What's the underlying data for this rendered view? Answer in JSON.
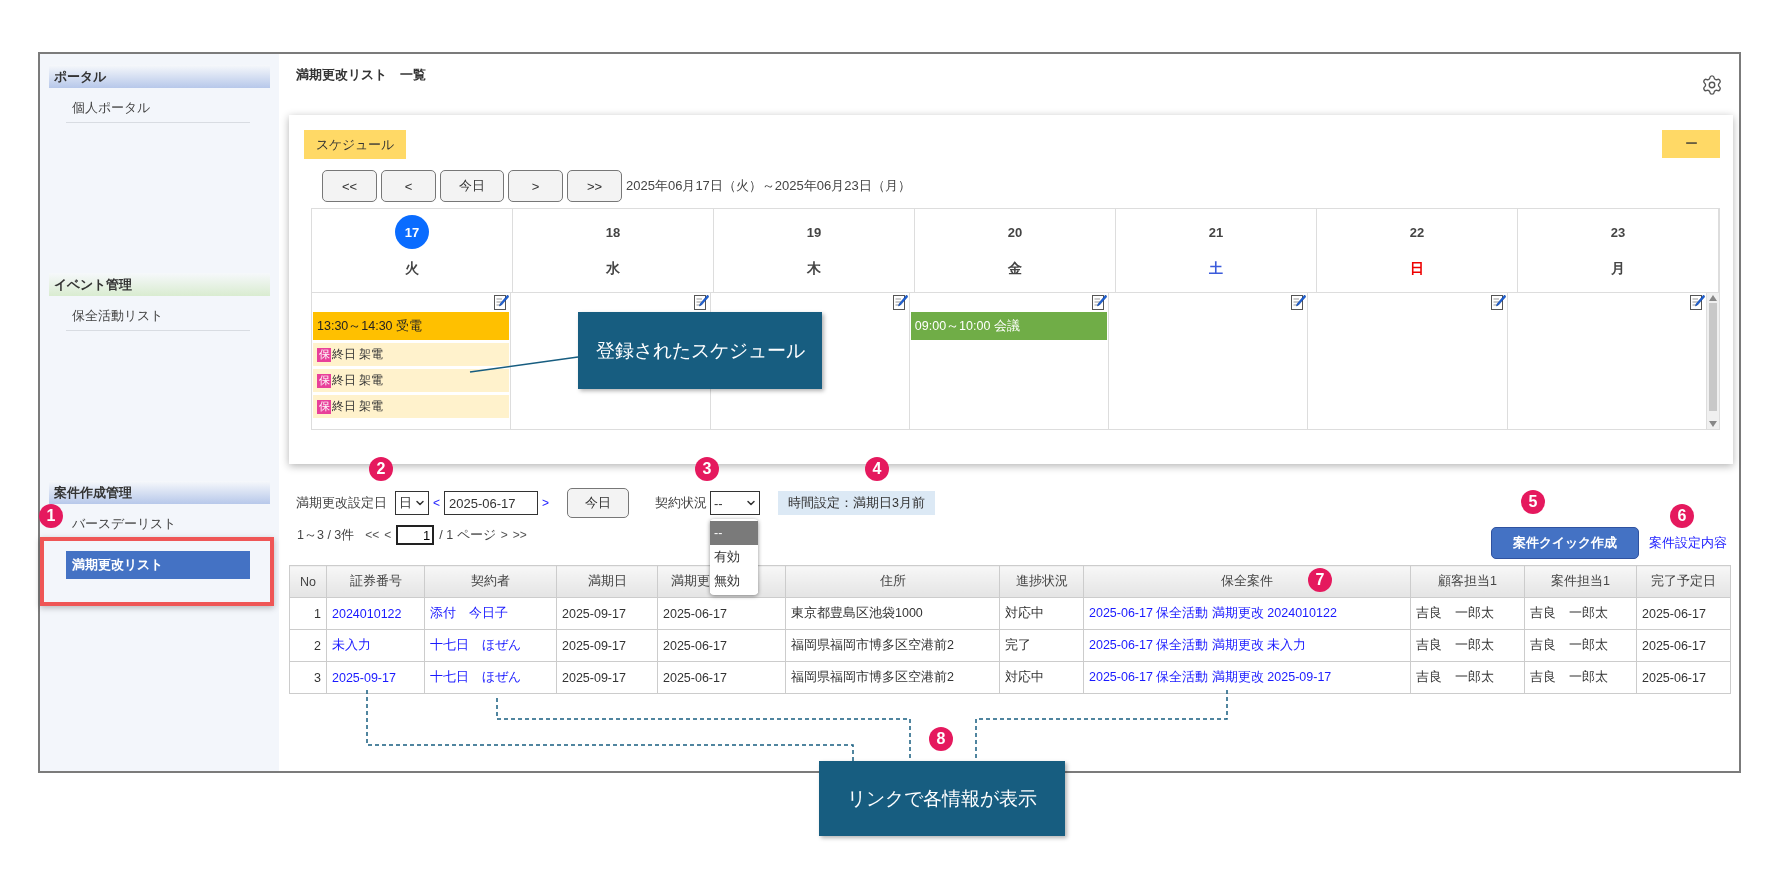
{
  "sidebar": {
    "sections": [
      {
        "title": "ポータル",
        "color": "#b7c8ea",
        "items": [
          {
            "label": "個人ポータル",
            "selected": false
          }
        ]
      },
      {
        "title": "イベント管理",
        "color": "#d9ecd0",
        "items": [
          {
            "label": "保全活動リスト",
            "selected": false
          }
        ]
      },
      {
        "title": "案件作成管理",
        "color": "#b7c8ea",
        "items": [
          {
            "label": "バースデーリスト",
            "selected": false
          },
          {
            "label": "満期更改リスト",
            "selected": true
          }
        ]
      }
    ]
  },
  "page_title": "満期更改リスト　一覧",
  "schedule": {
    "label": "スケジュール",
    "collapse_button": "ー",
    "nav_buttons": [
      "<<",
      "<",
      "今日",
      ">",
      ">>"
    ],
    "range": "2025年06月17日（火）～2025年06月23日（月）",
    "days": [
      {
        "date": "17",
        "weekday": "火",
        "today": true,
        "color": "#444444",
        "events": [
          {
            "kind": "timed",
            "text": "13:30～14:30 受電",
            "color": "#ffc000"
          },
          {
            "kind": "allday",
            "badge": "保",
            "text": "終日 架電"
          },
          {
            "kind": "allday",
            "badge": "保",
            "text": "終日 架電"
          },
          {
            "kind": "allday",
            "badge": "保",
            "text": "終日 架電"
          }
        ]
      },
      {
        "date": "18",
        "weekday": "水",
        "today": false,
        "color": "#444444"
      },
      {
        "date": "19",
        "weekday": "木",
        "today": false,
        "color": "#444444"
      },
      {
        "date": "20",
        "weekday": "金",
        "today": false,
        "color": "#444444",
        "events": [
          {
            "kind": "timed",
            "text": "09:00～10:00 会議",
            "color": "#70ad47"
          }
        ]
      },
      {
        "date": "21",
        "weekday": "土",
        "today": false,
        "color": "#3b5bdb"
      },
      {
        "date": "22",
        "weekday": "日",
        "today": false,
        "color": "#ee0000"
      },
      {
        "date": "23",
        "weekday": "月",
        "today": false,
        "color": "#444444"
      }
    ]
  },
  "filters": {
    "date_label": "満期更改設定日",
    "unit": "日",
    "prev": "<",
    "date": "2025-06-17",
    "next": ">",
    "today_button": "今日",
    "status_label": "契約状況",
    "status_value": "--",
    "status_options": [
      {
        "label": "--",
        "selected": true
      },
      {
        "label": "有効",
        "selected": false
      },
      {
        "label": "無効",
        "selected": false
      }
    ],
    "time_setting": "時間設定：満期日3月前"
  },
  "pagination": {
    "summary": "1～3 / 3件",
    "first": "<<",
    "prev": "<",
    "page": "1",
    "total": "/ 1 ページ",
    "next": ">",
    "last": ">>"
  },
  "actions": {
    "quick_create": "案件クイック作成",
    "settings_link": "案件設定内容"
  },
  "table": {
    "columns": [
      {
        "label": "No",
        "cut": false
      },
      {
        "label": "証券番号",
        "cut": false
      },
      {
        "label": "契約者",
        "cut": false
      },
      {
        "label": "満期日",
        "cut": false
      },
      {
        "label": "満期更",
        "cut": true
      },
      {
        "label": "住所",
        "cut": false
      },
      {
        "label": "進捗状況",
        "cut": false
      },
      {
        "label": "保全案件",
        "cut": false
      },
      {
        "label": "顧客担当1",
        "cut": false
      },
      {
        "label": "案件担当1",
        "cut": false
      },
      {
        "label": "完了予定日",
        "cut": false
      }
    ],
    "rows": [
      [
        {
          "text": "1",
          "link": false
        },
        {
          "text": "2024010122",
          "link": true
        },
        {
          "text": "添付　今日子",
          "link": true
        },
        {
          "text": "2025-09-17",
          "link": false
        },
        {
          "text": "2025-06-17",
          "link": false
        },
        {
          "text": "東京都豊島区池袋1000",
          "link": false
        },
        {
          "text": "対応中",
          "link": false
        },
        {
          "text": "2025-06-17 保全活動 満期更改 2024010122",
          "link": true
        },
        {
          "text": "吉良　一郎太",
          "link": false
        },
        {
          "text": "吉良　一郎太",
          "link": false
        },
        {
          "text": "2025-06-17",
          "link": false
        }
      ],
      [
        {
          "text": "2",
          "link": false
        },
        {
          "text": "未入力",
          "link": true
        },
        {
          "text": "十七日　ほぜん",
          "link": true
        },
        {
          "text": "2025-09-17",
          "link": false
        },
        {
          "text": "2025-06-17",
          "link": false
        },
        {
          "text": "福岡県福岡市博多区空港前2",
          "link": false
        },
        {
          "text": "完了",
          "link": false
        },
        {
          "text": "2025-06-17 保全活動 満期更改 未入力",
          "link": true
        },
        {
          "text": "吉良　一郎太",
          "link": false
        },
        {
          "text": "吉良　一郎太",
          "link": false
        },
        {
          "text": "2025-06-17",
          "link": false
        }
      ],
      [
        {
          "text": "3",
          "link": false
        },
        {
          "text": "2025-09-17",
          "link": true
        },
        {
          "text": "十七日　ほぜん",
          "link": true
        },
        {
          "text": "2025-09-17",
          "link": false
        },
        {
          "text": "2025-06-17",
          "link": false
        },
        {
          "text": "福岡県福岡市博多区空港前2",
          "link": false
        },
        {
          "text": "対応中",
          "link": false
        },
        {
          "text": "2025-06-17 保全活動 満期更改 2025-09-17",
          "link": true
        },
        {
          "text": "吉良　一郎太",
          "link": false
        },
        {
          "text": "吉良　一郎太",
          "link": false
        },
        {
          "text": "2025-06-17",
          "link": false
        }
      ]
    ]
  },
  "annotations": {
    "highlight": true,
    "badges": [
      "1",
      "2",
      "3",
      "4",
      "5",
      "6",
      "7",
      "8"
    ],
    "callouts": [
      "登録されたスケジュール",
      "リンクで各情報が表示"
    ]
  }
}
